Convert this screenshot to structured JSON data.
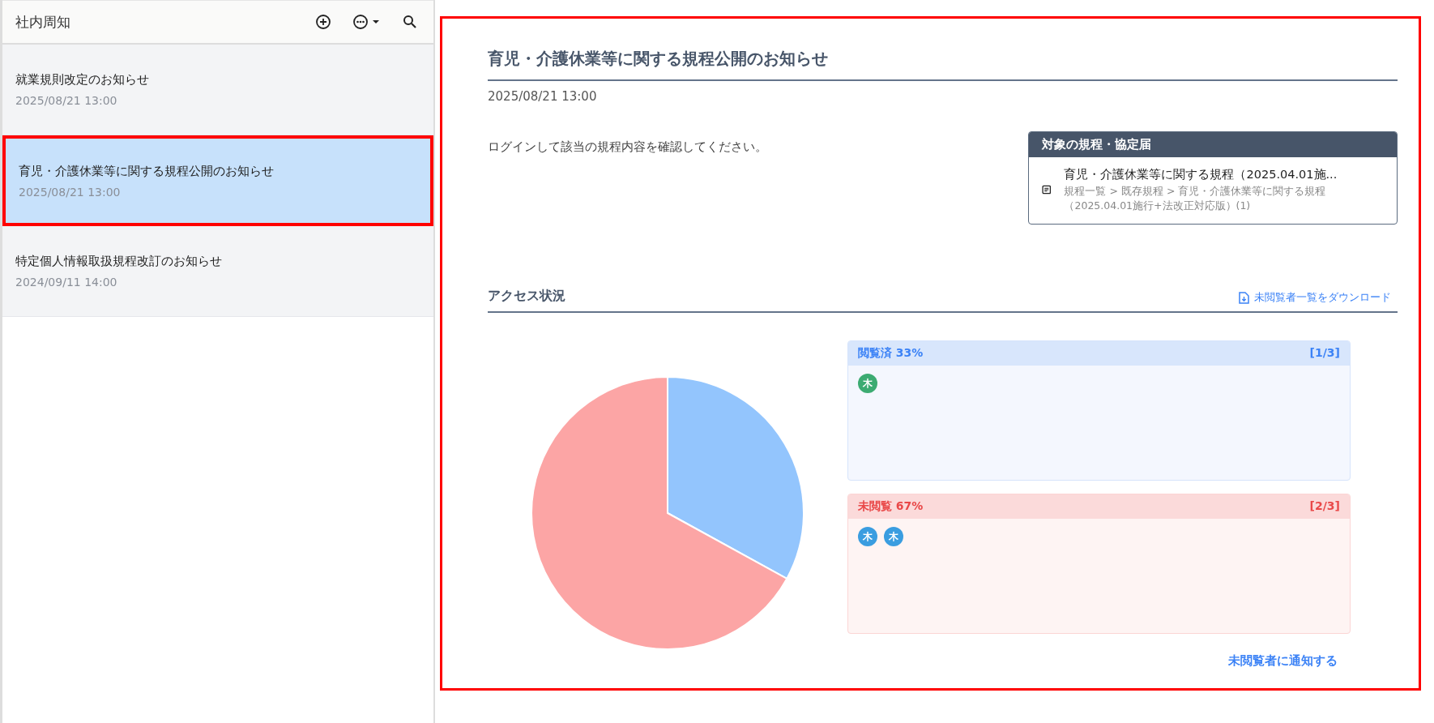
{
  "sidebar": {
    "title": "社内周知",
    "items": [
      {
        "title": "就業規則改定のお知らせ",
        "date": "2025/08/21 13:00",
        "selected": false,
        "highlighted": false
      },
      {
        "title": "育児・介護休業等に関する規程公開のお知らせ",
        "date": "2025/08/21 13:00",
        "selected": true,
        "highlighted": true
      },
      {
        "title": "特定個人情報取扱規程改訂のお知らせ",
        "date": "2024/09/11 14:00",
        "selected": false,
        "highlighted": false
      }
    ]
  },
  "content": {
    "highlighted": true,
    "title": "育児・介護休業等に関する規程公開のお知らせ",
    "date": "2025/08/21 13:00",
    "body": "ログインして該当の規程内容を確認してください。",
    "target_card": {
      "header": "対象の規程・協定届",
      "doc_title": "育児・介護休業等に関する規程（2025.04.01施...",
      "doc_path": "規程一覧 > 既存規程 > 育児・介護休業等に関する規程（2025.04.01施行+法改正対応版）(1)"
    },
    "access": {
      "title": "アクセス状況",
      "download_link": "未閲覧者一覧をダウンロード",
      "chart_data": {
        "type": "pie",
        "values": [
          33,
          67
        ],
        "colors": [
          "#93c5fd",
          "#fca5a5"
        ]
      },
      "groups": [
        {
          "kind": "read",
          "label": "閲覧済 33%",
          "count": "[1/3]",
          "users": [
            {
              "initial": "木",
              "color": "#3cab72"
            }
          ]
        },
        {
          "kind": "unread",
          "label": "未閲覧 67%",
          "count": "[2/3]",
          "users": [
            {
              "initial": "木",
              "color": "#3a9de0"
            },
            {
              "initial": "木",
              "color": "#3a9de0"
            }
          ]
        }
      ],
      "notify_link": "未閲覧者に通知する"
    }
  }
}
